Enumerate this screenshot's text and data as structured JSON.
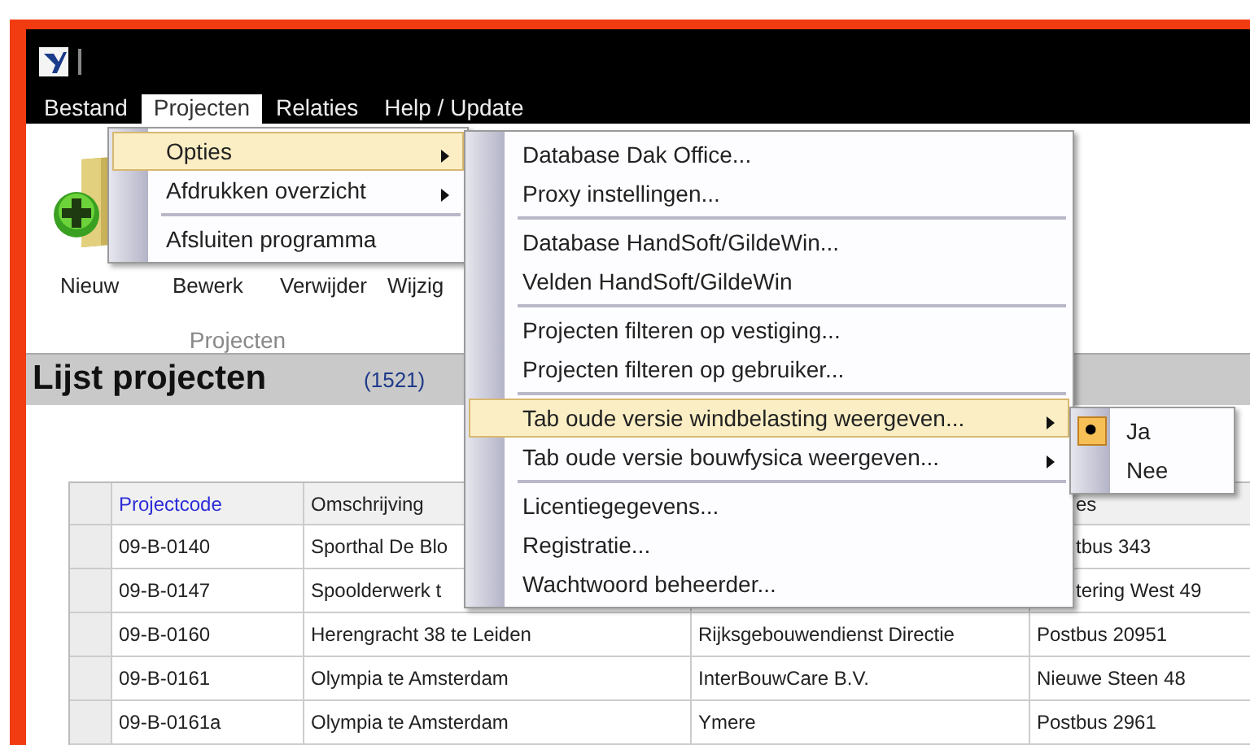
{
  "menubar": [
    {
      "label": "Bestand",
      "selected": false
    },
    {
      "label": "Projecten",
      "selected": true
    },
    {
      "label": "Relaties",
      "selected": false
    },
    {
      "label": "Help / Update",
      "selected": false
    }
  ],
  "ribbon": {
    "buttons": [
      "Nieuw",
      "Bewerk",
      "Verwijder",
      "Wijzig"
    ],
    "group_label": "Projecten"
  },
  "list_header": {
    "title": "Lijst projecten",
    "count": "(1521)"
  },
  "table": {
    "columns": [
      {
        "label": "Projectcode",
        "sorted": true
      },
      {
        "label": "Omschrijving",
        "sorted": false
      },
      {},
      {
        "label": "es",
        "sorted": false
      }
    ],
    "rows": [
      {
        "cells": [
          "09-B-0140",
          "Sporthal De Blo",
          null,
          "tbus 343"
        ]
      },
      {
        "cells": [
          "09-B-0147",
          "Spoolderwerk t",
          null,
          "tering West 49"
        ]
      },
      {
        "cells": [
          "09-B-0160",
          "Herengracht 38 te Leiden",
          "Rijksgebouwendienst Directie",
          "Postbus 20951"
        ]
      },
      {
        "cells": [
          "09-B-0161",
          "Olympia te Amsterdam",
          "InterBouwCare B.V.",
          "Nieuwe Steen 48"
        ]
      },
      {
        "cells": [
          "09-B-0161a",
          "Olympia te Amsterdam",
          "Ymere",
          "Postbus 2961"
        ]
      }
    ]
  },
  "menus": [
    {
      "items": [
        {
          "kind": "item",
          "label": "Opties",
          "submenu": true,
          "selected": true
        },
        {
          "kind": "item",
          "label": "Afdrukken overzicht",
          "submenu": true,
          "selected": false
        },
        {
          "kind": "separator"
        },
        {
          "kind": "item",
          "label": "Afsluiten programma",
          "submenu": false,
          "selected": false
        }
      ]
    },
    {
      "items": [
        {
          "kind": "item",
          "label": "Database Dak Office...",
          "submenu": false,
          "selected": false
        },
        {
          "kind": "item",
          "label": "Proxy instellingen...",
          "submenu": false,
          "selected": false
        },
        {
          "kind": "separator"
        },
        {
          "kind": "item",
          "label": "Database HandSoft/GildeWin...",
          "submenu": false,
          "selected": false
        },
        {
          "kind": "item",
          "label": "Velden HandSoft/GildeWin",
          "submenu": false,
          "selected": false
        },
        {
          "kind": "separator"
        },
        {
          "kind": "item",
          "label": "Projecten filteren op vestiging...",
          "submenu": false,
          "selected": false
        },
        {
          "kind": "item",
          "label": "Projecten filteren op gebruiker...",
          "submenu": false,
          "selected": false
        },
        {
          "kind": "separator"
        },
        {
          "kind": "item",
          "label": "Tab oude versie windbelasting weergeven...",
          "submenu": true,
          "selected": true
        },
        {
          "kind": "item",
          "label": "Tab oude versie bouwfysica weergeven...",
          "submenu": true,
          "selected": false
        },
        {
          "kind": "separator"
        },
        {
          "kind": "item",
          "label": "Licentiegegevens...",
          "submenu": false,
          "selected": false
        },
        {
          "kind": "item",
          "label": "Registratie...",
          "submenu": false,
          "selected": false
        },
        {
          "kind": "item",
          "label": "Wachtwoord beheerder...",
          "submenu": false,
          "selected": false
        }
      ]
    },
    {
      "items": [
        {
          "kind": "radio",
          "label": "Ja",
          "checked": true
        },
        {
          "kind": "radio",
          "label": "Nee",
          "checked": false
        }
      ]
    }
  ]
}
